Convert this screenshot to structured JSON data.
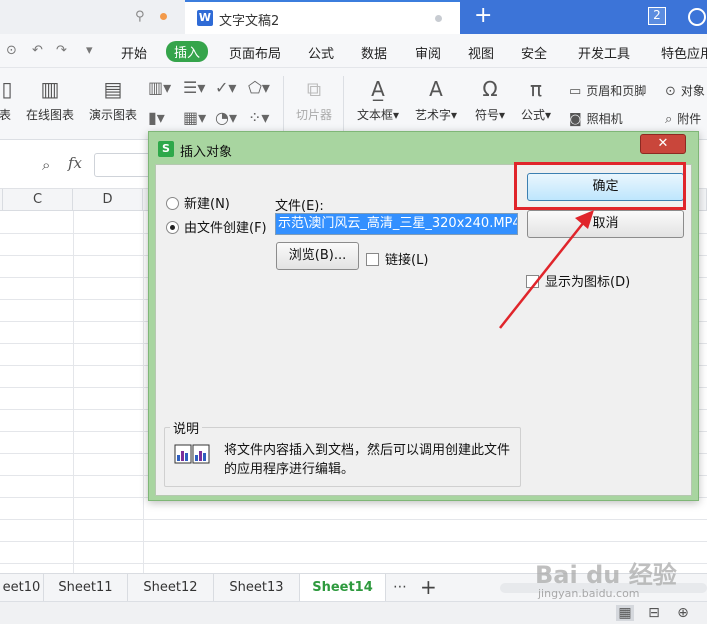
{
  "titlebar": {
    "doc_tab_icon": "W",
    "doc_tab_title": "文字文稿2",
    "new_tab": "+",
    "window_count": "2"
  },
  "menu": {
    "items": [
      "开始",
      "插入",
      "页面布局",
      "公式",
      "数据",
      "审阅",
      "视图",
      "安全",
      "开发工具",
      "特色应用"
    ],
    "active": "插入"
  },
  "ribbon": {
    "left_partial": "表",
    "online_chart": "在线图表",
    "demo_chart": "演示图表",
    "slicer": "切片器",
    "textbox": "文本框",
    "art_text": "艺术字",
    "symbol": "符号",
    "formula": "公式",
    "header_footer": "页眉和页脚",
    "camera": "照相机",
    "object": "对象",
    "attachment": "附件"
  },
  "formula_bar": {
    "fx_label": "fx"
  },
  "grid": {
    "columns": [
      "C",
      "D"
    ]
  },
  "sheets": {
    "tabs": [
      "eet10",
      "Sheet11",
      "Sheet12",
      "Sheet13",
      "Sheet14"
    ],
    "active": "Sheet14",
    "more": "⋯",
    "add": "+"
  },
  "dialog": {
    "title": "插入对象",
    "logo": "S",
    "close": "✕",
    "radio_new": "新建(N)",
    "radio_from_file": "由文件创建(F)",
    "file_label": "文件(E):",
    "file_value": "示范\\澳门风云_高清_三星_320x240.MP4",
    "browse": "浏览(B)...",
    "link": "链接(L)",
    "ok": "确定",
    "cancel": "取消",
    "show_as_icon": "显示为图标(D)",
    "desc_title": "说明",
    "desc_line1": "将文件内容插入到文档，然后可以调用创建此文件",
    "desc_line2": "的应用程序进行编辑。"
  },
  "watermark": {
    "brand": "Bai du 经验",
    "url": "jingyan.baidu.com"
  },
  "colors": {
    "accent_green": "#35a44b",
    "tab_blue": "#3c74d8",
    "highlight_red": "#e0252b",
    "dialog_frame": "#a8d5a0"
  }
}
